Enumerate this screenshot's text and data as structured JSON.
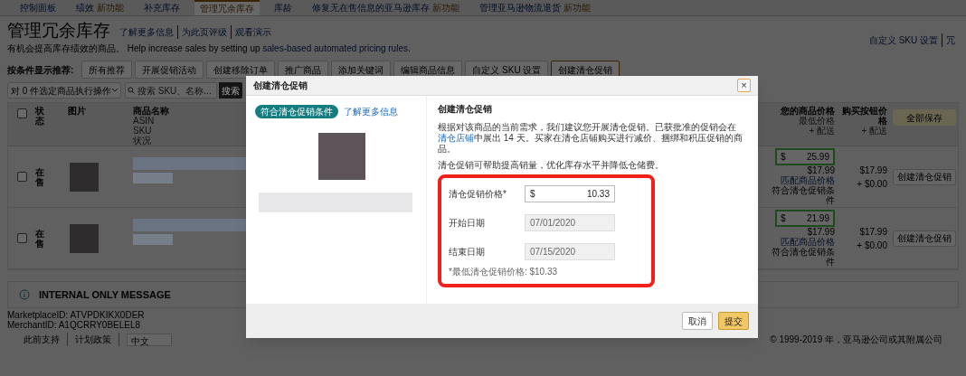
{
  "nav_tabs": [
    {
      "label": "控制面板",
      "selected": false
    },
    {
      "label": "绩效",
      "badge": "新功能",
      "selected": false
    },
    {
      "label": "补充库存",
      "selected": false
    },
    {
      "label": "管理冗余库存",
      "selected": true
    },
    {
      "label": "库龄",
      "selected": false
    },
    {
      "label": "修复无在售信息的亚马逊库存",
      "badge": "新功能",
      "selected": false
    },
    {
      "label": "管理亚马逊物流退货",
      "badge": "新功能",
      "selected": false
    }
  ],
  "header": {
    "title": "管理冗余库存",
    "links": [
      "了解更多信息",
      "为此页评级",
      "观看演示"
    ],
    "subtitle": "有机会提高库存绩效的商品。 Help increase sales by setting up ",
    "subtitle_link": "sales-based automated pricing rules",
    "subtitle_end": ".",
    "right_links": [
      "自定义 SKU 设置",
      "冗"
    ]
  },
  "filters": {
    "label": "按条件显示推荐:",
    "options": [
      {
        "label": "所有推荐",
        "selected": false
      },
      {
        "label": "开展促销活动",
        "selected": false
      },
      {
        "label": "创建移除订单",
        "selected": false
      },
      {
        "label": "推广商品",
        "selected": false
      },
      {
        "label": "添加关键词",
        "selected": false
      },
      {
        "label": "编辑商品信息",
        "selected": false
      },
      {
        "label": "自定义 SKU 设置",
        "selected": false
      },
      {
        "label": "创建清仓促销",
        "selected": true
      }
    ]
  },
  "toolbar": {
    "bulk_action": "对 0 件选定商品执行操作",
    "search_placeholder": "搜索 SKU、名称...",
    "search_button": "搜索"
  },
  "table": {
    "header_checked": false,
    "columns": [
      {
        "label": "状态"
      },
      {
        "label": "图片"
      },
      {
        "label": "商品名称",
        "sub": [
          "ASIN",
          "SKU",
          "状况"
        ]
      },
      {
        "label": "您的商品价格",
        "sub": [
          "最低价格",
          "+ 配送"
        ]
      },
      {
        "label": "购买按钮价格",
        "sub": [
          "+ 配送"
        ]
      }
    ],
    "save_all": "全部保存",
    "rows": [
      {
        "checked": false,
        "status": "在售",
        "currency": "$",
        "price": "25.99",
        "lowest": "$17.99",
        "match_link": "匹配商品价格",
        "eligible": "符合清仓促销条件",
        "buybox": "$17.99",
        "shipping": "+ $0.00",
        "action": "创建清仓促销"
      },
      {
        "checked": false,
        "status": "在售",
        "currency": "$",
        "price": "21.99",
        "lowest": "$17.99",
        "match_link": "匹配商品价格",
        "eligible": "符合清仓促销条件",
        "buybox": "$17.99",
        "shipping": "+ $0.00",
        "action": "创建清仓促销"
      }
    ]
  },
  "internal": {
    "title": "INTERNAL ONLY MESSAGE",
    "lines": [
      "MarketplaceID: ATVPDKIKX0DER",
      "MerchantID: A1QCRRY0BELEL8"
    ]
  },
  "footer": {
    "links": [
      "此前支持",
      "计划政策"
    ],
    "language": "中文",
    "copyright": "© 1999-2019 年，亚马逊公司或其附属公司"
  },
  "modal": {
    "title": "创建清仓促销",
    "close": "×",
    "badge": "符合清仓促销条件",
    "learn_more": "了解更多信息",
    "heading": "创建清仓促销",
    "paragraph_start": "根据对该商品的当前需求，我们建议您开展清仓促销。已获批准的促销会在",
    "paragraph_link": "清仓店铺",
    "paragraph_end": "中展出 14 天。买家在清仓店铺购买进行减价、捆绑和积压促销的商品。",
    "note_line": "清仓促销可帮助提高销量，优化库存水平并降低仓储费。",
    "fields": [
      {
        "label": "清仓促销价格*",
        "prefix": "$",
        "value": "10.33",
        "disabled": false
      },
      {
        "label": "开始日期",
        "value": "07/01/2020",
        "disabled": true
      },
      {
        "label": "结束日期",
        "value": "07/15/2020",
        "disabled": true
      }
    ],
    "min_price_note": "*最低清仓促销价格: $10.33",
    "buttons": [
      {
        "label": "取消",
        "kind": "secondary"
      },
      {
        "label": "提交",
        "kind": "primary"
      }
    ]
  }
}
